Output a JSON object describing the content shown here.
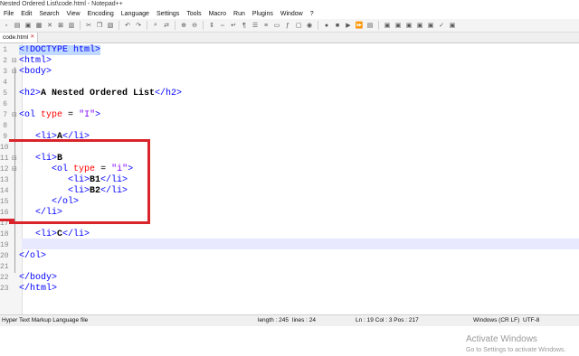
{
  "window": {
    "title": "Nested Ordered List\\code.html - Notepad++"
  },
  "menu": [
    "File",
    "Edit",
    "Search",
    "View",
    "Encoding",
    "Language",
    "Settings",
    "Tools",
    "Macro",
    "Run",
    "Plugins",
    "Window",
    "?"
  ],
  "tab": {
    "label": "code.html"
  },
  "editor": {
    "line_numbers": [
      "1",
      "2",
      "3",
      "4",
      "5",
      "6",
      "7",
      "8",
      "9",
      "10",
      "11",
      "12",
      "13",
      "14",
      "15",
      "16",
      "17",
      "18",
      "19",
      "20",
      "21",
      "22",
      "23"
    ],
    "lines": [
      {
        "kind": "doctype",
        "t": "<!DOCTYPE html>"
      },
      {
        "kind": "tag",
        "t": "<html>"
      },
      {
        "kind": "tag",
        "t": "<body>"
      },
      {
        "kind": "blank"
      },
      {
        "kind": "h2",
        "open": "<h2>",
        "text": "A Nested Ordered List",
        "close": "</h2>"
      },
      {
        "kind": "blank"
      },
      {
        "kind": "ol",
        "open": "<ol",
        "attr": "type",
        "eq": " = ",
        "val": "\"I\"",
        "end": ">"
      },
      {
        "kind": "blank"
      },
      {
        "kind": "li",
        "indent": "   ",
        "open": "<li>",
        "text": "A",
        "close": "</li>"
      },
      {
        "kind": "blank"
      },
      {
        "kind": "li",
        "indent": "   ",
        "open": "<li>",
        "text": "B",
        "close": ""
      },
      {
        "kind": "ol",
        "indent": "      ",
        "open": "<ol",
        "attr": "type",
        "eq": " = ",
        "val": "\"i\"",
        "end": ">"
      },
      {
        "kind": "li",
        "indent": "         ",
        "open": "<li>",
        "text": "B1",
        "close": "</li>"
      },
      {
        "kind": "li",
        "indent": "         ",
        "open": "<li>",
        "text": "B2",
        "close": "</li>"
      },
      {
        "kind": "tag",
        "indent": "      ",
        "t": "</ol>"
      },
      {
        "kind": "tag",
        "indent": "   ",
        "t": "</li>"
      },
      {
        "kind": "blank"
      },
      {
        "kind": "li",
        "indent": "   ",
        "open": "<li>",
        "text": "C",
        "close": "</li>"
      },
      {
        "kind": "blank"
      },
      {
        "kind": "tag",
        "t": "</ol>"
      },
      {
        "kind": "blank"
      },
      {
        "kind": "tag",
        "t": "</body>"
      },
      {
        "kind": "tag",
        "t": "</html>"
      }
    ]
  },
  "watermark": {
    "line1": "Activate Windows",
    "line2": "Go to Settings to activate Windows."
  },
  "status": {
    "language": "Hyper Text Markup Language file",
    "length": "length : 245",
    "lines": "lines : 24",
    "position": "Ln : 19    Col : 3    Pos : 217",
    "eol": "Windows (CR LF)",
    "encoding": "UTF-8"
  },
  "colors": {
    "tag": "#0000ff",
    "attr": "#ff0000",
    "string": "#8000ff",
    "annotation": "#d8242a"
  }
}
